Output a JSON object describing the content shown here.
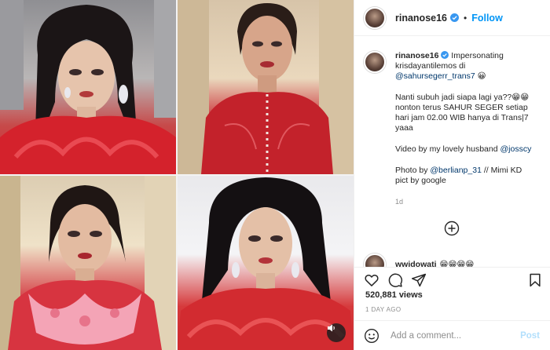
{
  "post": {
    "username": "rinanose16",
    "follow_label": "Follow",
    "separator": "•",
    "caption": {
      "username": "rinanose16",
      "line1": "Impersonating krisdayantilemos di",
      "mention1": "@sahursegerr_trans7",
      "emoji1": "😀",
      "para2": "Nanti subuh jadi siapa lagi ya??😁😁 nonton terus SAHUR SEGER setiap hari jam 02.00 WIB hanya di Trans|7 yaaa",
      "para3_text": "Video by my lovely husband ",
      "para3_mention": "@josscy",
      "para4_text": "Photo by ",
      "para4_mention": "@berlianp_31",
      "para4_rest": " // Mimi KD pict by google",
      "time": "1d"
    },
    "comment2": {
      "username": "wwidowati",
      "text": "😁😁😁😁"
    },
    "views": "520,881 views",
    "posted": "1 DAY AGO",
    "add_comment_placeholder": "Add a comment...",
    "post_label": "Post"
  },
  "icons": {
    "verified": "verified-badge-icon",
    "like": "heart-icon",
    "comment": "comment-icon",
    "share": "share-icon",
    "save": "bookmark-icon",
    "emoji": "emoji-icon",
    "load_more": "plus-circle-icon",
    "audio": "audio-icon"
  },
  "colors": {
    "accent": "#0095f6",
    "verified": "#3897f0",
    "dress_red": "#d3242c"
  }
}
